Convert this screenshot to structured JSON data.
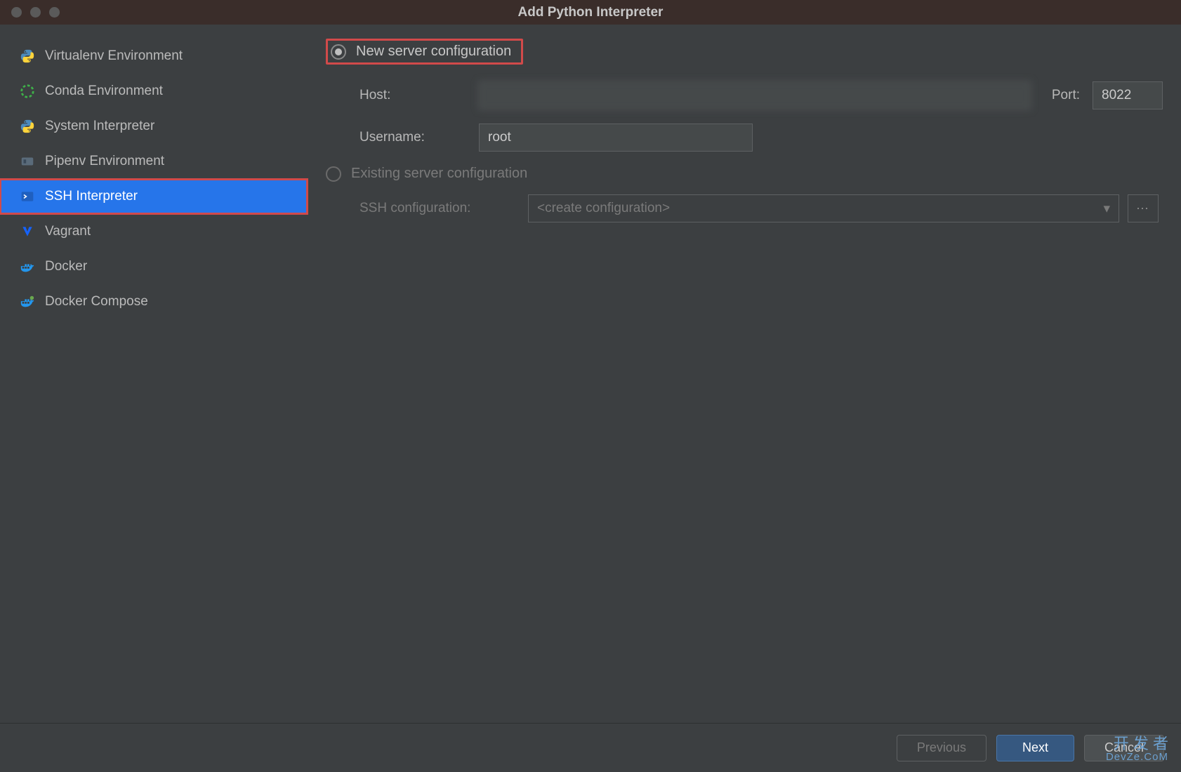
{
  "window": {
    "title": "Add Python Interpreter"
  },
  "sidebar": {
    "items": [
      {
        "label": "Virtualenv Environment",
        "icon": "python"
      },
      {
        "label": "Conda Environment",
        "icon": "conda"
      },
      {
        "label": "System Interpreter",
        "icon": "python"
      },
      {
        "label": "Pipenv Environment",
        "icon": "pipenv"
      },
      {
        "label": "SSH Interpreter",
        "icon": "ssh"
      },
      {
        "label": "Vagrant",
        "icon": "vagrant"
      },
      {
        "label": "Docker",
        "icon": "docker"
      },
      {
        "label": "Docker Compose",
        "icon": "docker-compose"
      }
    ],
    "selected_index": 4
  },
  "main": {
    "new_config": {
      "radio_label": "New server configuration",
      "host_label": "Host:",
      "host_value": "",
      "port_label": "Port:",
      "port_value": "8022",
      "username_label": "Username:",
      "username_value": "root"
    },
    "existing_config": {
      "radio_label": "Existing server configuration",
      "ssh_config_label": "SSH configuration:",
      "ssh_config_placeholder": "<create configuration>"
    },
    "selected_radio": "new"
  },
  "footer": {
    "previous": "Previous",
    "next": "Next",
    "cancel": "Cancel"
  },
  "watermark": {
    "line1": "开 发 者",
    "line2": "DevZe.CoM"
  }
}
